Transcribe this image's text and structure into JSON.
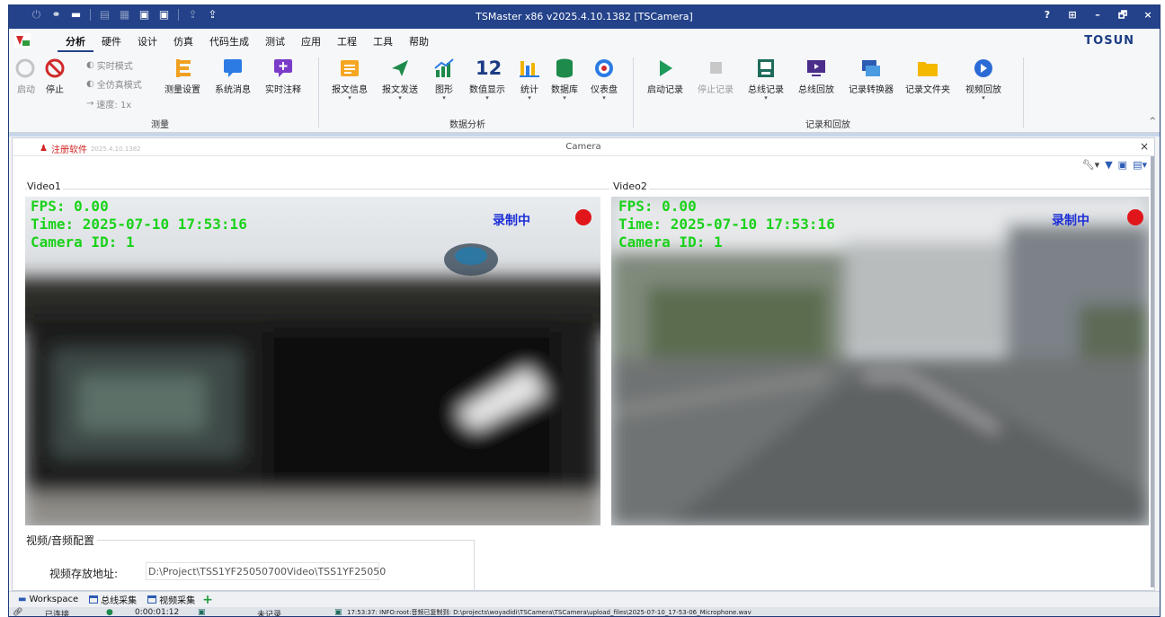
{
  "window": {
    "title": "TSMaster x86 v2025.4.10.1382 [TSCamera]",
    "controls": [
      "?",
      "⊞",
      "–",
      "🗗",
      "×"
    ]
  },
  "quick_access_icons": [
    "power-icon",
    "link-icon",
    "message-icon",
    "stop-icon",
    "save-icon",
    "save-as-icon",
    "upload-icon",
    "upload-icon"
  ],
  "menu": {
    "items": [
      "分析",
      "硬件",
      "设计",
      "仿真",
      "代码生成",
      "测试",
      "应用",
      "工程",
      "工具",
      "帮助"
    ],
    "active": "分析",
    "brand": "TOSUN"
  },
  "ribbon": {
    "start_label": "启动",
    "stop_label": "停止",
    "realtime_mode": "实时模式",
    "full_sim_mode": "全仿真模式",
    "speed": "速度: 1x",
    "measure_settings": "测量设置",
    "system_messages": "系统消息",
    "realtime_comment": "实时注释",
    "group_measure": "测量",
    "message_info": "报文信息",
    "message_send": "报文发送",
    "graphics": "图形",
    "value_display": "数值显示",
    "value_icon_text": "12",
    "statistics": "统计",
    "database": "数据库",
    "dashboard": "仪表盘",
    "group_data_analysis": "数据分析",
    "start_record": "启动记录",
    "stop_record": "停止记录",
    "bus_record": "总线记录",
    "bus_replay": "总线回放",
    "record_converter": "记录转换器",
    "record_folder": "记录文件夹",
    "video_replay": "视频回放",
    "group_record_replay": "记录和回放"
  },
  "panel": {
    "register": "注册软件",
    "version": "2025.4.10.1382",
    "title": "Camera",
    "close": "×"
  },
  "videos": [
    {
      "label": "Video1",
      "fps": "FPS: 0.00",
      "time": "Time: 2025-07-10 17:53:16",
      "camera_id": "Camera ID: 1",
      "recording": "录制中"
    },
    {
      "label": "Video2",
      "fps": "FPS: 0.00",
      "time": "Time: 2025-07-10 17:53:16",
      "camera_id": "Camera ID: 1",
      "recording": "录制中"
    }
  ],
  "config": {
    "title": "视频/音频配置",
    "path_label": "视频存放地址:",
    "path_value": "D:\\Project\\TSS1YF25050700Video\\TSS1YF25050"
  },
  "tabs": [
    {
      "label": "Workspace"
    },
    {
      "label": "总线采集"
    },
    {
      "label": "视频采集"
    }
  ],
  "status": {
    "connected": "已连接",
    "elapsed": "0:00:01:12",
    "record_state": "未记录",
    "log": "17:53:37: INFO:root:音频已复制到: D:\\projects\\woyadidi\\TSCamera\\TSCamera\\upload_files\\2025-07-10_17-53-06_Microphone.wav"
  },
  "colors": {
    "titlebar": "#23428a",
    "overlay_text": "#1bd21b",
    "recording_text": "#1c2ed6",
    "rec_dot": "#e0161b"
  }
}
